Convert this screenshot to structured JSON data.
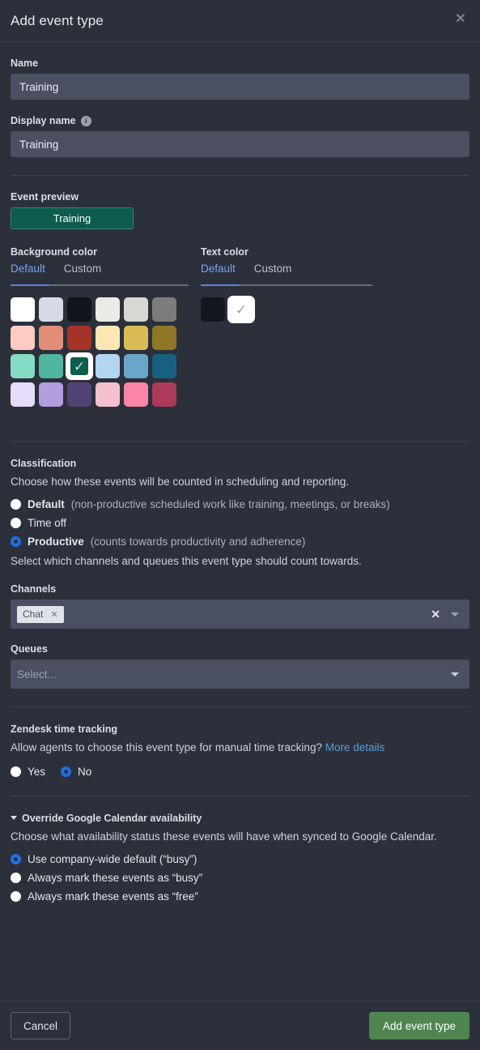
{
  "modal": {
    "title": "Add event type",
    "close_icon": "close-icon"
  },
  "fields": {
    "name_label": "Name",
    "name_value": "Training",
    "name_placeholder": "",
    "display_name_label": "Display name",
    "display_name_info_icon": "info-icon",
    "display_name_value": "Training",
    "display_name_placeholder": ""
  },
  "preview": {
    "label": "Event preview",
    "chip_text": "Training",
    "chip_bg": "#0d5c4d",
    "chip_fg": "#ffffff"
  },
  "background_color": {
    "label": "Background color",
    "tabs": [
      "Default",
      "Custom"
    ],
    "active_tab": "Default",
    "selected_index": 14,
    "swatches": [
      "#ffffff",
      "#d6dae5",
      "#12141b",
      "#eaeae7",
      "#d7d8d2",
      "#7c7c7a",
      "#fbccc3",
      "#e28d78",
      "#a63328",
      "#fbe7b5",
      "#d9bc56",
      "#8f7725",
      "#84dbc6",
      "#51b6a1",
      "#0d5c4d",
      "#b3d6ef",
      "#69a6ca",
      "#17607f",
      "#e6dcfa",
      "#b29ddf",
      "#514275",
      "#f4c0cd",
      "#fa85a4",
      "#ac3a5b"
    ]
  },
  "text_color": {
    "label": "Text color",
    "tabs": [
      "Default",
      "Custom"
    ],
    "active_tab": "Default",
    "selected_index": 1,
    "swatches": [
      "#14161d",
      "#ffffff"
    ]
  },
  "classification": {
    "title": "Classification",
    "description": "Choose how these events will be counted in scheduling and reporting.",
    "options": [
      {
        "label": "Default",
        "hint": "(non-productive scheduled work like training, meetings, or breaks)",
        "selected": false
      },
      {
        "label": "Time off",
        "hint": "",
        "selected": false
      },
      {
        "label": "Productive",
        "hint": "(counts towards productivity and adherence)",
        "selected": true
      }
    ],
    "sub_description": "Select which channels and queues this event type should count towards."
  },
  "channels": {
    "label": "Channels",
    "tags": [
      {
        "label": "Chat",
        "remove_icon": "close-icon"
      }
    ],
    "clear_icon": "clear-icon",
    "chevron_icon": "chevron-down-icon"
  },
  "queues": {
    "label": "Queues",
    "placeholder": "Select...",
    "chevron_icon": "chevron-down-icon"
  },
  "zendesk": {
    "title": "Zendesk time tracking",
    "description": "Allow agents to choose this event type for manual time tracking?",
    "link_text": "More details",
    "options": [
      {
        "label": "Yes",
        "selected": false
      },
      {
        "label": "No",
        "selected": true
      }
    ]
  },
  "gcal": {
    "title": "Override Google Calendar availability",
    "caret_icon": "caret-down-icon",
    "description": "Choose what availability status these events will have when synced to Google Calendar.",
    "options": [
      {
        "label": "Use company-wide default (“busy”)",
        "selected": true
      },
      {
        "label": "Always mark these events as “busy”",
        "selected": false
      },
      {
        "label": "Always mark these events as “free”",
        "selected": false
      }
    ]
  },
  "footer": {
    "cancel_label": "Cancel",
    "submit_label": "Add event type",
    "submit_color": "#4f8551"
  }
}
